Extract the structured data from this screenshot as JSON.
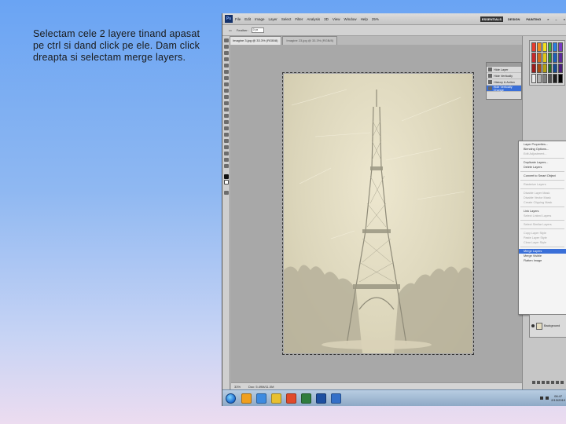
{
  "slide": {
    "instruction_line1": "Selectam cele 2 layere tinand apasat",
    "instruction_line2": "pe ctrl si dand click pe ele. Dam click",
    "instruction_line3": "dreapta si selectam merge layers."
  },
  "photoshop": {
    "logo": "Ps",
    "menu": [
      "File",
      "Edit",
      "Image",
      "Layer",
      "Select",
      "Filter",
      "Analysis",
      "3D",
      "View",
      "Window",
      "Help"
    ],
    "zoom_menu": "25%",
    "workspaces": [
      "ESSENTIALS",
      "DESIGN",
      "PAINTING"
    ],
    "options": {
      "label": "Feather:",
      "value": "0 px"
    },
    "tabs": [
      "Imagine 3.jpg @ 33.3% (RGB/8)",
      "Imagine 23.jpg @ 33.3% (RGB/8)"
    ],
    "status": {
      "zoom": "33%",
      "doc": "Doc: 5.49M/11.0M"
    },
    "mini_panel_rows": [
      "Hide Layer",
      "Hide Vertically",
      "History & Action",
      "Hide Vertically Change"
    ],
    "context_menu": {
      "items": [
        {
          "label": "Layer Properties...",
          "state": "normal"
        },
        {
          "label": "Blending Options...",
          "state": "normal"
        },
        {
          "label": "Edit Adjustment...",
          "state": "disabled"
        },
        {
          "sep": true
        },
        {
          "label": "Duplicate Layers...",
          "state": "normal"
        },
        {
          "label": "Delete Layers",
          "state": "normal"
        },
        {
          "sep": true
        },
        {
          "label": "Convert to Smart Object",
          "state": "normal"
        },
        {
          "sep": true
        },
        {
          "label": "Rasterize Layers",
          "state": "disabled"
        },
        {
          "sep": true
        },
        {
          "label": "Disable Layer Mask",
          "state": "disabled"
        },
        {
          "label": "Disable Vector Mask",
          "state": "disabled"
        },
        {
          "label": "Create Clipping Mask",
          "state": "disabled"
        },
        {
          "sep": true
        },
        {
          "label": "Link Layers",
          "state": "normal"
        },
        {
          "label": "Select Linked Layers",
          "state": "disabled"
        },
        {
          "sep": true
        },
        {
          "label": "Select Similar Layers",
          "state": "disabled"
        },
        {
          "sep": true
        },
        {
          "label": "Copy Layer Style",
          "state": "disabled"
        },
        {
          "label": "Paste Layer Style",
          "state": "disabled"
        },
        {
          "label": "Clear Layer Style",
          "state": "disabled"
        },
        {
          "sep": true
        },
        {
          "label": "Merge Layers",
          "state": "highlight"
        },
        {
          "label": "Merge Visible",
          "state": "normal"
        },
        {
          "label": "Flatten Image",
          "state": "normal"
        }
      ]
    },
    "layer_name": "Background",
    "clock_time": "06:47",
    "clock_date": "2/13/2010"
  },
  "colors": {
    "accent": "#3a6fd8",
    "swatches": [
      "#e83b2e",
      "#f08a1e",
      "#f4e21e",
      "#3fb13c",
      "#2a7de0",
      "#7a3bc4",
      "#c9292a",
      "#d06a1e",
      "#e0c818",
      "#2f9030",
      "#1c5fb8",
      "#5d2b9a",
      "#9e1c1c",
      "#a74e12",
      "#b5a010",
      "#246e24",
      "#154a90",
      "#4a1f7a",
      "#e8e8e8",
      "#b0b0b0",
      "#808080",
      "#505050",
      "#202020",
      "#000000"
    ],
    "taskbar_icons": [
      "#f0a020",
      "#3d8be0",
      "#e8c030",
      "#e04a2a",
      "#2f7d3f",
      "#1d4fa0",
      "#3470c8"
    ]
  }
}
